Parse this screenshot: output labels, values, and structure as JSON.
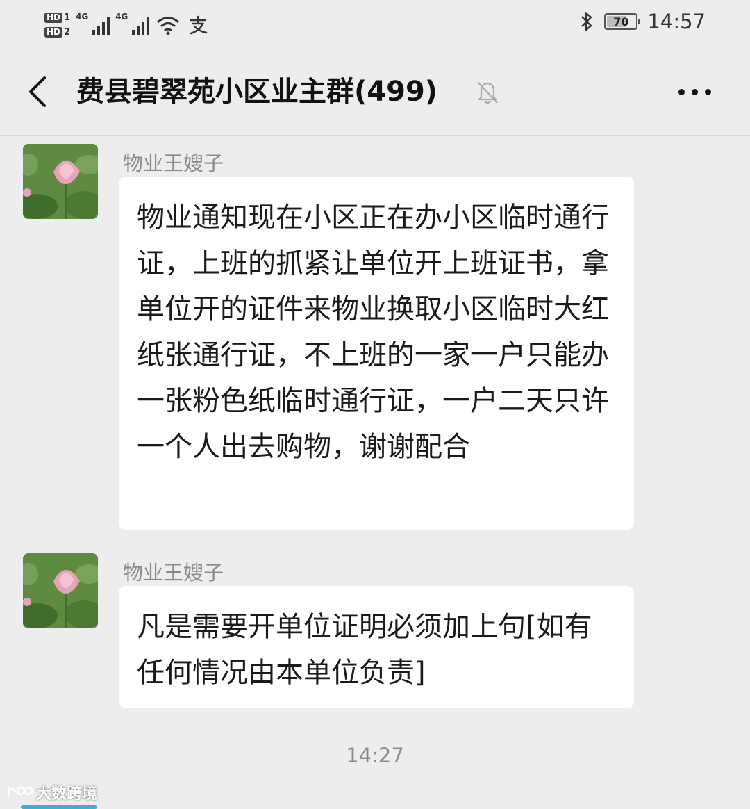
{
  "status_bar": {
    "hd1": "HD",
    "hd1_sim": "1",
    "hd2": "HD",
    "hd2_sim": "2",
    "net1": "4G",
    "net2": "4G",
    "battery": "70",
    "battery_level": 0.7,
    "time": "14:57",
    "icons": [
      "signal-icon",
      "wifi-icon",
      "alipay-icon",
      "bluetooth-icon",
      "battery-icon"
    ]
  },
  "header": {
    "title": "费县碧翠苑小区业主群(499)",
    "icons": [
      "back-arrow-icon",
      "mute-bell-icon",
      "more-icon"
    ]
  },
  "messages": [
    {
      "sender": "物业王嫂子",
      "text": "物业通知现在小区正在办小区临时通行证，上班的抓紧让单位开上班证书，拿单位开的证件来物业换取小区临时大红纸张通行证，不上班的一家一户只能办一张粉色纸临时通行证，一户二天只许一个人出去购物，谢谢配合"
    },
    {
      "sender": "物业王嫂子",
      "text": "凡是需要开单位证明必须加上句[如有任何情况由本单位负责]"
    }
  ],
  "timestamp": "14:27",
  "watermark": "大数跨境",
  "colors": {
    "background": "#ededed",
    "bubble": "#ffffff",
    "text": "#1a1a1a",
    "muted": "#8a8a8a"
  }
}
